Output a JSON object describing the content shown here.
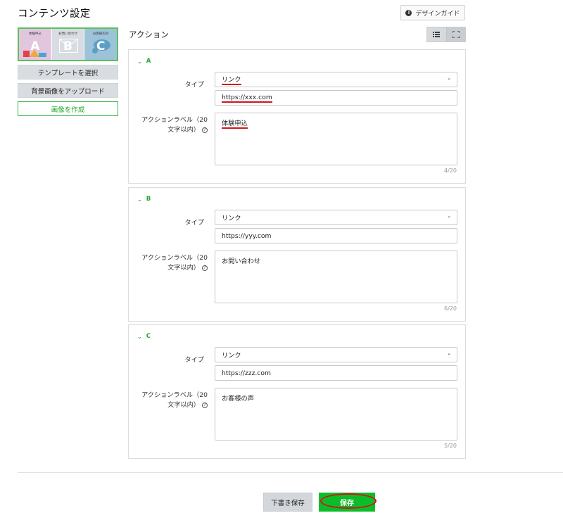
{
  "page": {
    "title": "コンテンツ設定"
  },
  "header": {
    "guide_label": "デザインガイド",
    "guide_icon": "info-icon"
  },
  "thumbnail": {
    "cells": [
      {
        "caption": "体験申込",
        "letter": "A"
      },
      {
        "caption": "お問い合わせ",
        "letter": "B"
      },
      {
        "caption": "お客様の声",
        "letter": "C"
      }
    ]
  },
  "sidebar": {
    "template_label": "テンプレートを選択",
    "upload_label": "背景画像をアップロード",
    "create_label": "画像を作成"
  },
  "main": {
    "section_title": "アクション",
    "view_icons": [
      "list-icon",
      "expand-icon"
    ]
  },
  "panels": [
    {
      "name": "A",
      "type_label": "タイプ",
      "type_value": "リンク",
      "url": "https://xxx.com",
      "action_label_line1": "アクションラベル（20",
      "action_label_line2": "文字以内）",
      "action_value": "体験申込",
      "count": "4/20"
    },
    {
      "name": "B",
      "type_label": "タイプ",
      "type_value": "リンク",
      "url": "https://yyy.com",
      "action_label_line1": "アクションラベル（20",
      "action_label_line2": "文字以内）",
      "action_value": "お問い合わせ",
      "count": "6/20"
    },
    {
      "name": "C",
      "type_label": "タイプ",
      "type_value": "リンク",
      "url": "https://zzz.com",
      "action_label_line1": "アクションラベル（20",
      "action_label_line2": "文字以内）",
      "action_value": "お客様の声",
      "count": "5/20"
    }
  ],
  "footer": {
    "draft_label": "下書き保存",
    "save_label": "保存"
  },
  "colors": {
    "accent_green": "#0bbd29",
    "annotation_red": "#d0161b"
  }
}
